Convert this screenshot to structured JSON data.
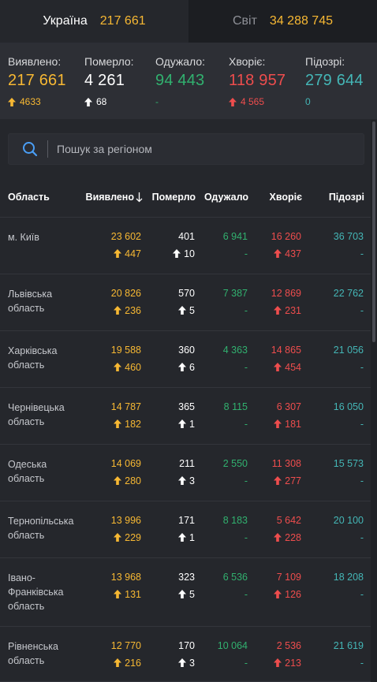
{
  "tabs": [
    {
      "name": "Україна",
      "value": "217 661"
    },
    {
      "name": "Світ",
      "value": "34 288 745"
    }
  ],
  "summary": [
    {
      "label": "Виявлено:",
      "value": "217 661",
      "delta": "4633",
      "color": "#f7b833",
      "arrow": true
    },
    {
      "label": "Померло:",
      "value": "4 261",
      "delta": "68",
      "color": "#ffffff",
      "arrow": true
    },
    {
      "label": "Одужало:",
      "value": "94 443",
      "delta": "-",
      "color": "#31b16f",
      "arrow": false
    },
    {
      "label": "Хворіє:",
      "value": "118 957",
      "delta": "4 565",
      "color": "#ee4d4d",
      "arrow": true
    },
    {
      "label": "Підозрі:",
      "value": "279 644",
      "delta": "0",
      "color": "#44b6b6",
      "arrow": false
    }
  ],
  "search": {
    "placeholder": "Пошук за регіоном"
  },
  "table": {
    "headers": {
      "region": "Область",
      "confirmed": "Виявлено",
      "deaths": "Померло",
      "recovered": "Одужало",
      "sick": "Хворіє",
      "suspected": "Підозрі"
    },
    "sort_icon": "arrow-down-icon",
    "rows": [
      {
        "region": "м. Київ",
        "confirmed": "23 602",
        "confirmed_delta": "447",
        "deaths": "401",
        "deaths_delta": "10",
        "recovered": "6 941",
        "recovered_delta": "-",
        "sick": "16 260",
        "sick_delta": "437",
        "suspected": "36 703",
        "suspected_delta": "-"
      },
      {
        "region": "Львівська область",
        "confirmed": "20 826",
        "confirmed_delta": "236",
        "deaths": "570",
        "deaths_delta": "5",
        "recovered": "7 387",
        "recovered_delta": "-",
        "sick": "12 869",
        "sick_delta": "231",
        "suspected": "22 762",
        "suspected_delta": "-"
      },
      {
        "region": "Харківська область",
        "confirmed": "19 588",
        "confirmed_delta": "460",
        "deaths": "360",
        "deaths_delta": "6",
        "recovered": "4 363",
        "recovered_delta": "-",
        "sick": "14 865",
        "sick_delta": "454",
        "suspected": "21 056",
        "suspected_delta": "-"
      },
      {
        "region": "Чернівецька область",
        "confirmed": "14 787",
        "confirmed_delta": "182",
        "deaths": "365",
        "deaths_delta": "1",
        "recovered": "8 115",
        "recovered_delta": "-",
        "sick": "6 307",
        "sick_delta": "181",
        "suspected": "16 050",
        "suspected_delta": "-"
      },
      {
        "region": "Одеська область",
        "confirmed": "14 069",
        "confirmed_delta": "280",
        "deaths": "211",
        "deaths_delta": "3",
        "recovered": "2 550",
        "recovered_delta": "-",
        "sick": "11 308",
        "sick_delta": "277",
        "suspected": "15 573",
        "suspected_delta": "-"
      },
      {
        "region": "Тернопільська область",
        "confirmed": "13 996",
        "confirmed_delta": "229",
        "deaths": "171",
        "deaths_delta": "1",
        "recovered": "8 183",
        "recovered_delta": "-",
        "sick": "5 642",
        "sick_delta": "228",
        "suspected": "20 100",
        "suspected_delta": "-"
      },
      {
        "region": "Івано-Франківська область",
        "confirmed": "13 968",
        "confirmed_delta": "131",
        "deaths": "323",
        "deaths_delta": "5",
        "recovered": "6 536",
        "recovered_delta": "-",
        "sick": "7 109",
        "sick_delta": "126",
        "suspected": "18 208",
        "suspected_delta": "-"
      },
      {
        "region": "Рівненська область",
        "confirmed": "12 770",
        "confirmed_delta": "216",
        "deaths": "170",
        "deaths_delta": "3",
        "recovered": "10 064",
        "recovered_delta": "-",
        "sick": "2 536",
        "sick_delta": "213",
        "suspected": "21 619",
        "suspected_delta": "-"
      }
    ]
  },
  "colors": {
    "background": "#25272c",
    "summary_bg": "#2d2f35",
    "confirmed": "#f7b833",
    "deaths": "#ffffff",
    "recovered": "#31b16f",
    "sick": "#ee4d4d",
    "suspected": "#44b6b6",
    "accent_search": "#4a9ef5"
  }
}
